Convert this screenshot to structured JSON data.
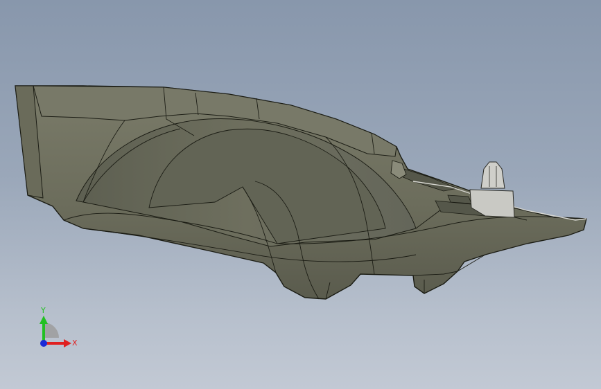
{
  "viewport": {
    "background_top": "#8897ac",
    "background_bottom": "#c2c9d4"
  },
  "model": {
    "fill_main": "#6f7060",
    "fill_shadow": "#5e6052",
    "fill_light": "#7c7d6c",
    "edge_color": "#1b1c14",
    "clip_fill": "#c9c9c4"
  },
  "triad": {
    "x_label": "X",
    "y_label": "Y",
    "x_color": "#e02020",
    "y_color": "#22c022",
    "z_color": "#1a2ad8"
  }
}
